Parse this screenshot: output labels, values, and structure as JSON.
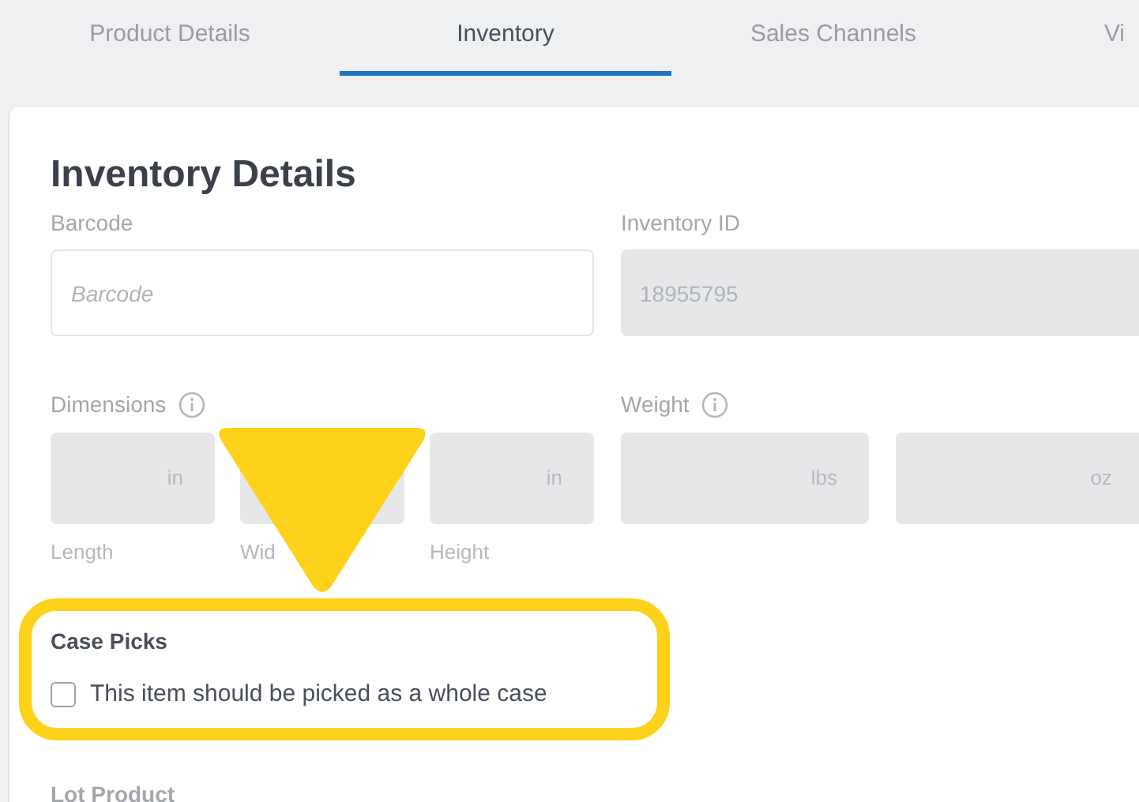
{
  "tabs": [
    {
      "label": "Product Details",
      "selected": false
    },
    {
      "label": "Inventory",
      "selected": true
    },
    {
      "label": "Sales Channels",
      "selected": false
    },
    {
      "label": "Vi",
      "selected": false
    }
  ],
  "section_title": "Inventory Details",
  "barcode": {
    "label": "Barcode",
    "placeholder": "Barcode"
  },
  "inventory_id": {
    "label": "Inventory ID",
    "value": "18955795",
    "disabled": true
  },
  "dimensions": {
    "label": "Dimensions",
    "fields": [
      {
        "unit": "in",
        "caption": "Length"
      },
      {
        "caption": "Wid"
      },
      {
        "unit": "in",
        "caption": "Height"
      }
    ]
  },
  "weight": {
    "label": "Weight",
    "fields": [
      {
        "unit": "lbs"
      },
      {
        "unit": "oz"
      }
    ]
  },
  "case_picks": {
    "label": "Case Picks",
    "checkbox_label": "This item should be picked as a whole case",
    "checked": false
  },
  "lot_product": {
    "label": "Lot Product"
  }
}
